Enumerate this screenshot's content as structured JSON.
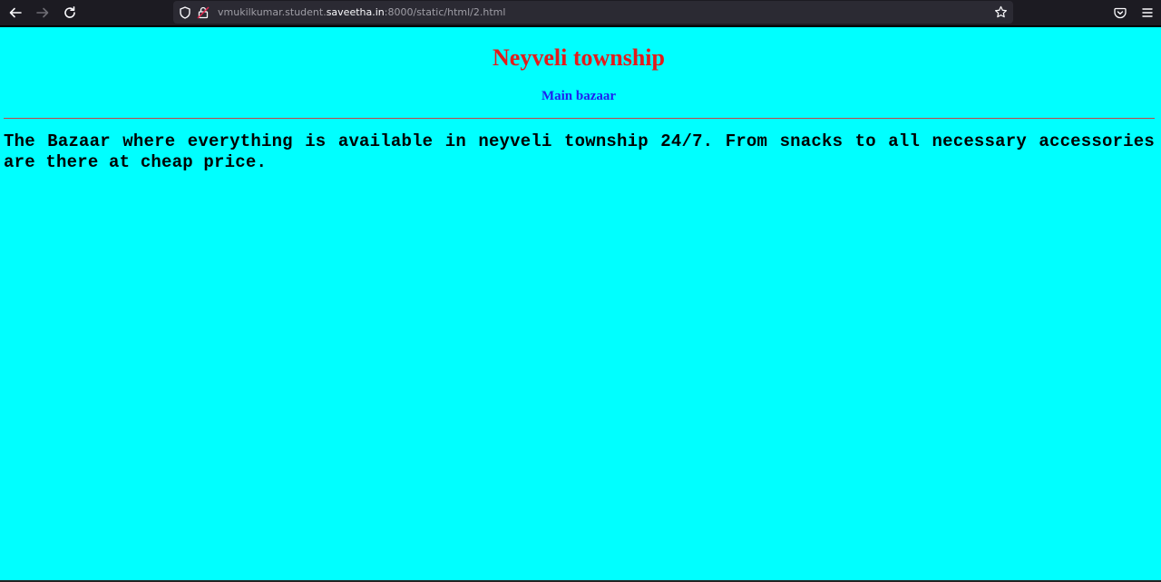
{
  "browser": {
    "url_prefix": "vmukilkumar.student.",
    "url_host": "saveetha.in",
    "url_suffix": ":8000/static/html/2.html"
  },
  "page": {
    "title": "Neyveli township",
    "subtitle": "Main bazaar",
    "paragraph": "The Bazaar where everything is available in neyveli township 24/7. From snacks to all necessary accessories are there at cheap price.",
    "background_color": "#00ffff",
    "title_color": "#e31b1b",
    "subtitle_color": "#1f1ff0"
  },
  "icons": {
    "back": "back-arrow-icon",
    "forward": "forward-arrow-icon",
    "reload": "reload-icon",
    "shield": "tracking-protection-shield-icon",
    "lock": "insecure-connection-icon",
    "bookmark": "bookmark-star-icon",
    "pocket": "pocket-icon",
    "menu": "hamburger-menu-icon"
  }
}
